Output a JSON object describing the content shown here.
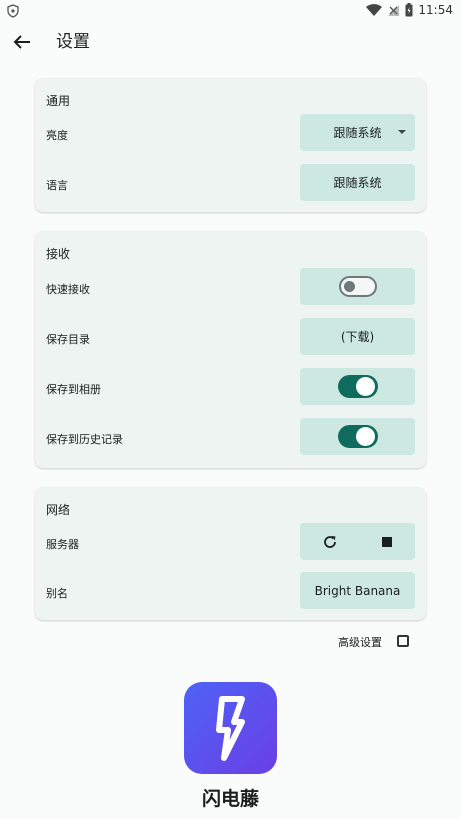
{
  "status_bar": {
    "time": "11:54"
  },
  "header": {
    "title": "设置",
    "back_icon": "arrow-left-icon"
  },
  "general": {
    "title": "通用",
    "brightness": {
      "label": "亮度",
      "value": "跟随系统"
    },
    "language": {
      "label": "语言",
      "value": "跟随系统"
    }
  },
  "receive": {
    "title": "接收",
    "quick_receive": {
      "label": "快速接收",
      "on": false
    },
    "save_dir": {
      "label": "保存目录",
      "value": "(下载)"
    },
    "save_to_gallery": {
      "label": "保存到相册",
      "on": true
    },
    "save_to_history": {
      "label": "保存到历史记录",
      "on": true
    }
  },
  "network": {
    "title": "网络",
    "server": {
      "label": "服务器"
    },
    "alias": {
      "label": "别名",
      "value": "Bright Banana"
    }
  },
  "advanced": {
    "label": "高级设置",
    "checked": false
  },
  "app": {
    "name": "闪电藤"
  },
  "colors": {
    "accent": "#0e6b5e",
    "card": "#edf4f1",
    "control": "#cce8e1",
    "logo_from": "#4d63f5",
    "logo_to": "#6b3fe6"
  }
}
